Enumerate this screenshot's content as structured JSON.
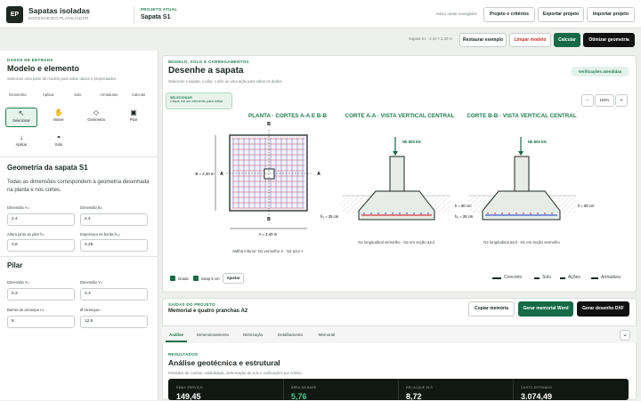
{
  "app": {
    "logo": "EP",
    "name": "Sapatas isoladas",
    "subtitle": "ENGENHEIRO PLANEJADOR"
  },
  "project": {
    "label": "PROJETO ATUAL",
    "name": "Sapata S1"
  },
  "header": {
    "saved": "Salvo neste navegador",
    "buttons": [
      "Projeto e critérios",
      "Exportar projeto",
      "Importar projeto"
    ]
  },
  "toolbar": {
    "dims": "Sapata S1 · 2,40 × 2,40 m",
    "restore": "Restaurar exemplo",
    "clear": "Limpar modelo",
    "compute": "Calcular",
    "optimize": "Otimizar geometria"
  },
  "sidebar": {
    "section": "DADOS DE ENTRADA",
    "title": "Modelo e elemento",
    "desc": "Selecione uma parte do modelo para editar dados e propriedades.",
    "crumbs": [
      "Geometria",
      "Aplicar",
      "Solo",
      "Armaduras",
      "Calcular"
    ],
    "tools": [
      {
        "label": "Selecionar",
        "icon": "cursor-icon",
        "glyph": "↖"
      },
      {
        "label": "Mover",
        "icon": "hand-icon",
        "glyph": "✋"
      },
      {
        "label": "Geometria",
        "icon": "diamond-icon",
        "glyph": "◇"
      },
      {
        "label": "Pilar",
        "icon": "pillar-icon",
        "glyph": "▣"
      },
      {
        "label": "Aplicar",
        "icon": "arrow-down-icon",
        "glyph": "↓"
      },
      {
        "label": "Solo",
        "icon": "soil-icon",
        "glyph": "◓"
      }
    ],
    "geom_title": "Geometria da sapata S1",
    "geom_desc": "Todas as dimensões correspondem à geometria desenhada na planta e nos cortes.",
    "fields": [
      {
        "label": "Dimensão A=",
        "value": "2.4"
      },
      {
        "label": "Dimensão B=",
        "value": "2.4"
      },
      {
        "label": "Altura junto ao pilar h=",
        "value": "0.8"
      },
      {
        "label": "Espessura na borda h₀=",
        "value": "0.25"
      }
    ],
    "pilar_title": "Pilar",
    "pilar_fields": [
      {
        "label": "Dimensão X=",
        "value": "0.3"
      },
      {
        "label": "Dimensão Y=",
        "value": "0.3"
      },
      {
        "label": "Barras de arranque n=",
        "value": "8"
      },
      {
        "label": "Ø arranque=",
        "value": "12.5"
      }
    ]
  },
  "canvas": {
    "section": "MODELO, SOLO E CARREGAMENTOS",
    "title": "Desenhe a sapata",
    "desc": "Selecione a sapata, o pilar, o solo ou uma ação para editar os dados.",
    "badge": "Verificações atendidas",
    "hint_title": "SELECIONAR",
    "hint_text": "Clique em um elemento para editar",
    "zoom": "100%",
    "views": [
      "PLANTA · CORTES A-A E B-B",
      "CORTE A-A · VISTA VERTICAL CENTRAL",
      "CORTE B-B · VISTA VERTICAL CENTRAL"
    ],
    "plan": {
      "a": "A",
      "b": "B",
      "dimB": "B = 2,40 m",
      "dimA": "A = 2,40 m",
      "caption": "Malha inferior: N1 vermelho X · N2 azul Y"
    },
    "section_a": {
      "load": "Nk 800 kN",
      "h": "h = 80 cm",
      "h0": "h₀ = 25 cm",
      "caption": "N1 longitudinal vermelho · N2 em seção azul"
    },
    "section_b": {
      "load": "Nk 800 kN",
      "h": "h = 80 cm",
      "caption": "N2 longitudinal azul · N1 em seção vermelho"
    },
    "options": {
      "grid": "Grade",
      "snap": "Snap 5 cm",
      "fit": "Ajustar"
    },
    "legend": [
      "Concreto",
      "Solo",
      "Ações",
      "Armadura"
    ]
  },
  "output": {
    "section": "SAÍDAS DO PROJETO",
    "title": "Memorial e quatro pranchas A2",
    "copy": "Copiar memória",
    "word": "Gerar memorial Word",
    "dxf": "Gerar desenho DXF",
    "tabs": [
      "Análise",
      "Dimensionamento",
      "Otimização",
      "Detalhamento",
      "Memorial"
    ],
    "results_section": "RESULTADOS",
    "results_title": "Análise geotécnica e estrutural",
    "results_desc": "Pressões de contato, estabilidade, deformação do solo e verificações por critério.",
    "cards": [
      {
        "label": "EMAX SERVIÇO",
        "value": "149,45"
      },
      {
        "label": "ÁREA DA BASE",
        "value": "5,76"
      },
      {
        "label": "RECALQUE ELS",
        "value": "8,72"
      },
      {
        "label": "CUSTO ESTIMADO",
        "value": "3.074,49"
      }
    ]
  },
  "colors": {
    "accent": "#146b46",
    "rebar_x": "#d63a3a",
    "rebar_y": "#3a5bd6"
  }
}
